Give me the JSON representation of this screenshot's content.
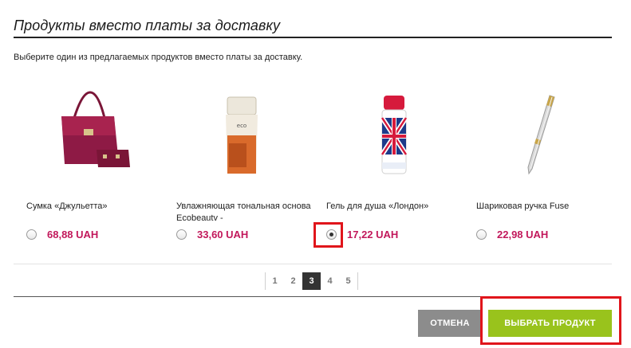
{
  "dialog": {
    "title": "Продукты вместо платы за доставку",
    "intro": "Выберите один из предлагаемых продуктов вместо платы за доставку."
  },
  "products": [
    {
      "name": "Сумка «Джульетта»",
      "price": "68,88 UAH",
      "selected": false,
      "icon": "handbag-icon"
    },
    {
      "name": "Увлажняющая тональная основа Ecobeautv -",
      "price": "33,60 UAH",
      "selected": false,
      "icon": "foundation-tube-icon"
    },
    {
      "name": "Гель для душа «Лондон»",
      "price": "17,22 UAH",
      "selected": true,
      "icon": "shower-gel-bottle-icon"
    },
    {
      "name": "Шариковая ручка Fuse",
      "price": "22,98 UAH",
      "selected": false,
      "icon": "ballpoint-pen-icon"
    }
  ],
  "pagination": {
    "pages": [
      "1",
      "2",
      "3",
      "4",
      "5"
    ],
    "current": "3"
  },
  "buttons": {
    "cancel_label": "ОТМЕНА",
    "select_label": "ВЫБРАТЬ ПРОДУКТ"
  },
  "colors": {
    "price": "#c2185b",
    "select_button": "#99c31c",
    "cancel_button": "#8c8c8c",
    "highlight": "#e0151b"
  }
}
